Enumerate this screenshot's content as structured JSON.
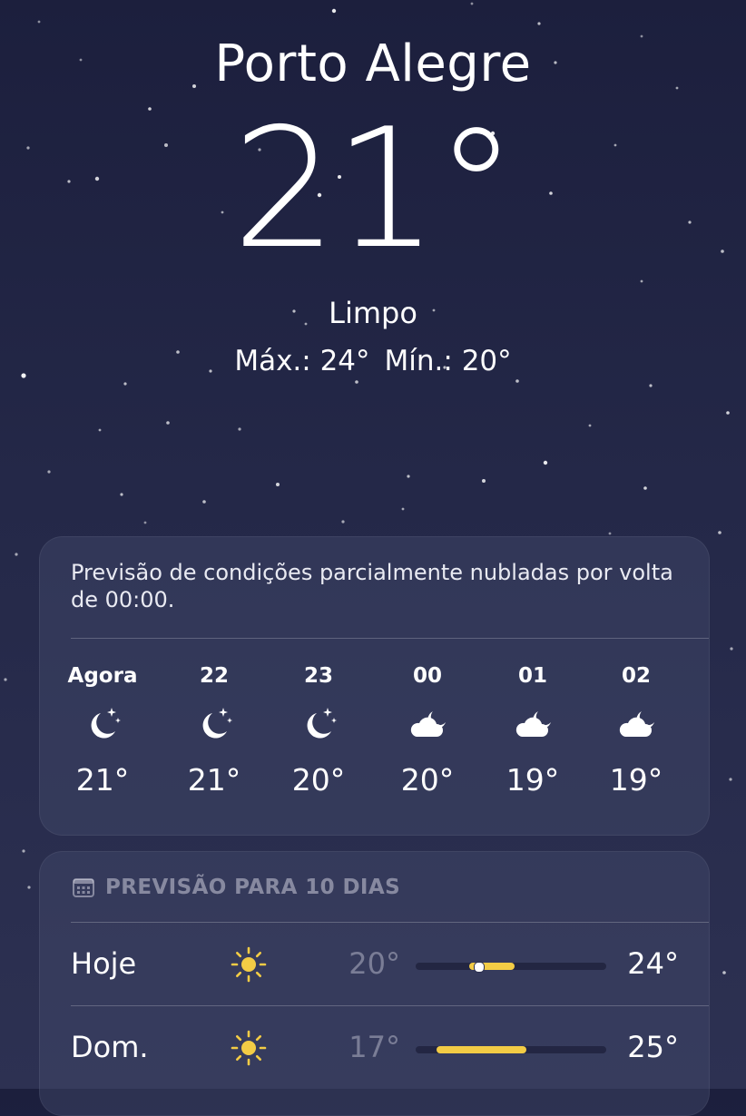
{
  "location": {
    "city": "Porto Alegre",
    "temperature": "21°",
    "condition": "Limpo",
    "high_label": "Máx.: 24°",
    "low_label": "Mín.: 20°"
  },
  "hourly_card": {
    "summary": "Previsão de condições parcialmente nubladas por volta de 00:00.",
    "hours": [
      {
        "label": "Agora",
        "icon": "moon-stars-icon",
        "temp": "21°"
      },
      {
        "label": "22",
        "icon": "moon-stars-icon",
        "temp": "21°"
      },
      {
        "label": "23",
        "icon": "moon-stars-icon",
        "temp": "20°"
      },
      {
        "label": "00",
        "icon": "cloud-moon-icon",
        "temp": "20°"
      },
      {
        "label": "01",
        "icon": "cloud-moon-icon",
        "temp": "19°"
      },
      {
        "label": "02",
        "icon": "cloud-moon-icon",
        "temp": "19°"
      }
    ]
  },
  "daily_card": {
    "title": "PREVISÃO PARA 10 DIAS",
    "title_icon": "calendar-icon",
    "days": [
      {
        "day": "Hoje",
        "icon": "sun-icon",
        "low": "20°",
        "high": "24°",
        "range_start": 0.28,
        "range_end": 0.52,
        "current": 0.33
      },
      {
        "day": "Dom.",
        "icon": "sun-icon",
        "low": "17°",
        "high": "25°",
        "range_start": 0.11,
        "range_end": 0.58,
        "current": null
      }
    ]
  },
  "colors": {
    "background_top": "#1c1f3d",
    "background_bottom": "#2d3152",
    "sun": "#f3cc45",
    "range_fill": "#f3cc45"
  }
}
